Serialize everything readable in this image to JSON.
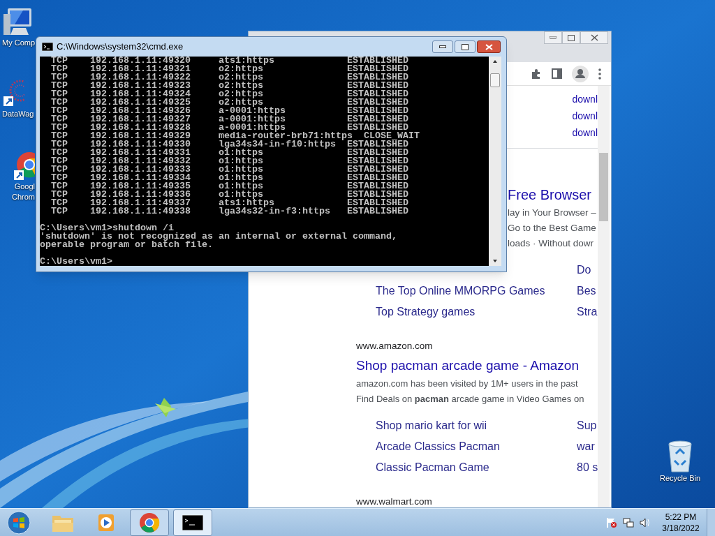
{
  "desktop_icons": [
    {
      "kind": "computer",
      "label_lines": [
        "My Comp"
      ]
    },
    {
      "kind": "art-shortcut",
      "label_lines": [
        "DataWag"
      ]
    },
    {
      "kind": "chrome-shortcut",
      "label_lines": [
        "Googl",
        "Chrom"
      ]
    },
    {
      "kind": "recycle",
      "label_lines": [
        "Recycle Bin"
      ]
    }
  ],
  "browser": {
    "top_links": [
      "downl",
      "downl",
      "downl"
    ],
    "result_1": {
      "title": "Free Browser",
      "snippet_lines": [
        "lay in Your Browser –",
        "Go to the Best Game",
        "loads · Without dowr"
      ],
      "sitelinks": [
        {
          "right": "Do"
        },
        {
          "left": "The Top Online MMORPG Games",
          "right": "Bes"
        },
        {
          "left": "Top Strategy games",
          "right": "Stra"
        }
      ]
    },
    "result_2": {
      "site": "www.amazon.com",
      "title": "Shop pacman arcade game - Amazon",
      "snippet_lines": [
        "amazon.com has been visited by 1M+ users in the past",
        "Find Deals on **pacman** arcade game in Video Games on"
      ],
      "sitelinks": [
        {
          "left": "Shop mario kart for wii",
          "right": "Sup"
        },
        {
          "left": "Arcade Classics Pacman",
          "right": "war"
        },
        {
          "left": "Classic Pacman Game",
          "right": "80 s"
        }
      ]
    },
    "next_site": "www.walmart.com"
  },
  "console": {
    "title": "C:\\Windows\\system32\\cmd.exe",
    "connections": [
      {
        "proto": "TCP",
        "local": "192.168.1.11:49320",
        "foreign": "ats1:https",
        "state": "ESTABLISHED"
      },
      {
        "proto": "TCP",
        "local": "192.168.1.11:49321",
        "foreign": "o2:https",
        "state": "ESTABLISHED"
      },
      {
        "proto": "TCP",
        "local": "192.168.1.11:49322",
        "foreign": "o2:https",
        "state": "ESTABLISHED"
      },
      {
        "proto": "TCP",
        "local": "192.168.1.11:49323",
        "foreign": "o2:https",
        "state": "ESTABLISHED"
      },
      {
        "proto": "TCP",
        "local": "192.168.1.11:49324",
        "foreign": "o2:https",
        "state": "ESTABLISHED"
      },
      {
        "proto": "TCP",
        "local": "192.168.1.11:49325",
        "foreign": "o2:https",
        "state": "ESTABLISHED"
      },
      {
        "proto": "TCP",
        "local": "192.168.1.11:49326",
        "foreign": "a-0001:https",
        "state": "ESTABLISHED"
      },
      {
        "proto": "TCP",
        "local": "192.168.1.11:49327",
        "foreign": "a-0001:https",
        "state": "ESTABLISHED"
      },
      {
        "proto": "TCP",
        "local": "192.168.1.11:49328",
        "foreign": "a-0001:https",
        "state": "ESTABLISHED"
      },
      {
        "proto": "TCP",
        "local": "192.168.1.11:49329",
        "foreign": "media-router-brb71:https",
        "state": "CLOSE_WAIT"
      },
      {
        "proto": "TCP",
        "local": "192.168.1.11:49330",
        "foreign": "lga34s34-in-f10:https",
        "state": "ESTABLISHED"
      },
      {
        "proto": "TCP",
        "local": "192.168.1.11:49331",
        "foreign": "o1:https",
        "state": "ESTABLISHED"
      },
      {
        "proto": "TCP",
        "local": "192.168.1.11:49332",
        "foreign": "o1:https",
        "state": "ESTABLISHED"
      },
      {
        "proto": "TCP",
        "local": "192.168.1.11:49333",
        "foreign": "o1:https",
        "state": "ESTABLISHED"
      },
      {
        "proto": "TCP",
        "local": "192.168.1.11:49334",
        "foreign": "o1:https",
        "state": "ESTABLISHED"
      },
      {
        "proto": "TCP",
        "local": "192.168.1.11:49335",
        "foreign": "o1:https",
        "state": "ESTABLISHED"
      },
      {
        "proto": "TCP",
        "local": "192.168.1.11:49336",
        "foreign": "o1:https",
        "state": "ESTABLISHED"
      },
      {
        "proto": "TCP",
        "local": "192.168.1.11:49337",
        "foreign": "ats1:https",
        "state": "ESTABLISHED"
      },
      {
        "proto": "TCP",
        "local": "192.168.1.11:49338",
        "foreign": "lga34s32-in-f3:https",
        "state": "ESTABLISHED"
      }
    ],
    "output_lines": [
      {
        "kind": "prompt",
        "text": "C:\\Users\\vm1>shutdown /i"
      },
      {
        "kind": "message",
        "text": "'shutdown' is not recognized as an internal or external command,"
      },
      {
        "kind": "message",
        "text": "operable program or batch file."
      },
      {
        "kind": "prompt",
        "text": "C:\\Users\\vm1>"
      }
    ]
  },
  "taskbar": {
    "apps": [
      {
        "kind": "folder",
        "running": false,
        "selected": false
      },
      {
        "kind": "media",
        "running": false,
        "selected": false
      },
      {
        "kind": "chrome",
        "running": true,
        "selected": false
      },
      {
        "kind": "console",
        "running": true,
        "selected": true
      }
    ],
    "clock_time": "5:22 PM",
    "clock_date": "3/18/2022"
  }
}
